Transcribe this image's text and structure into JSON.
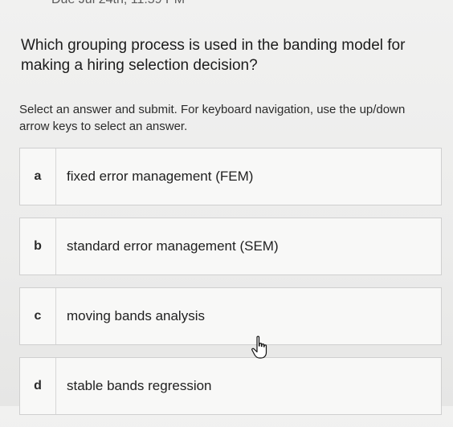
{
  "due_text": "Due Jul 24th, 11:59 PM",
  "question": "Which grouping process is used in the banding model for making a hiring selection decision?",
  "instructions": "Select an answer and submit. For keyboard navigation, use the up/down arrow keys to select an answer.",
  "options": [
    {
      "letter": "a",
      "text": "fixed error management (FEM)"
    },
    {
      "letter": "b",
      "text": "standard error management (SEM)"
    },
    {
      "letter": "c",
      "text": "moving bands analysis"
    },
    {
      "letter": "d",
      "text": "stable bands regression"
    }
  ],
  "cursor_icon": "hand-pointer-icon"
}
